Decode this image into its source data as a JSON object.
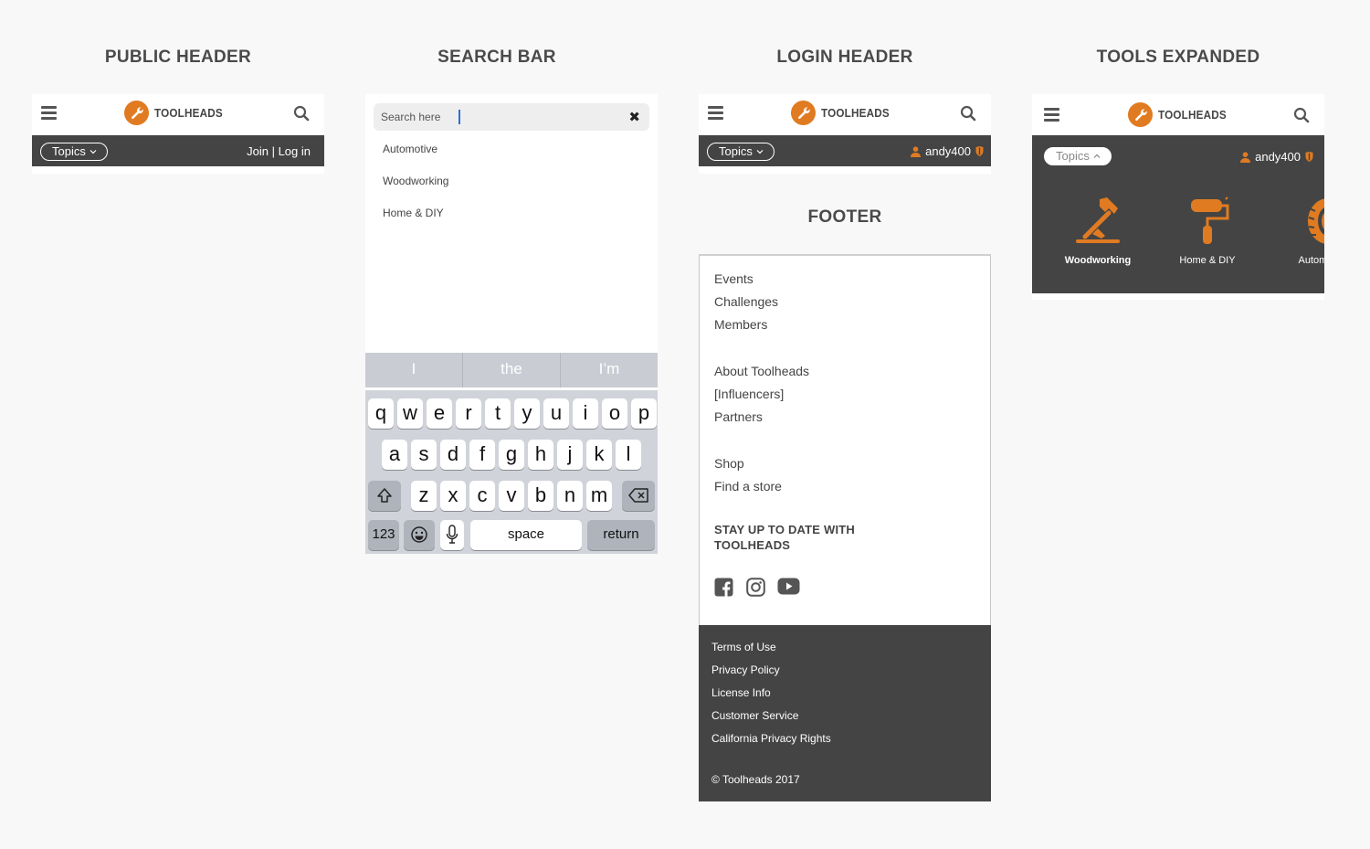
{
  "sections": {
    "public_header": "PUBLIC HEADER",
    "search_bar": "SEARCH BAR",
    "login_header": "LOGIN HEADER",
    "tools_expanded": "TOOLS EXPANDED",
    "footer": "FOOTER"
  },
  "brand": {
    "name": "TOOLHEADS",
    "accent": "#e07b22",
    "dark": "#444444"
  },
  "header": {
    "topics_label": "Topics",
    "auth_label": "Join | Log in",
    "username": "andy400"
  },
  "search": {
    "placeholder": "Search here",
    "suggestions": [
      "Automotive",
      "Woodworking",
      "Home & DIY"
    ]
  },
  "keyboard": {
    "predictions": [
      "I",
      "the",
      "I’m"
    ],
    "row1": [
      "q",
      "w",
      "e",
      "r",
      "t",
      "y",
      "u",
      "i",
      "o",
      "p"
    ],
    "row2": [
      "a",
      "s",
      "d",
      "f",
      "g",
      "h",
      "j",
      "k",
      "l"
    ],
    "row3": [
      "z",
      "x",
      "c",
      "v",
      "b",
      "n",
      "m"
    ],
    "numbers_key": "123",
    "space_key": "space",
    "return_key": "return"
  },
  "footer": {
    "group1": [
      "Events",
      "Challenges",
      "Members"
    ],
    "group2": [
      "About Toolheads",
      "[Influencers]",
      "Partners"
    ],
    "group3": [
      "Shop",
      "Find a store"
    ],
    "newsletter_heading_line1": "STAY UP TO DATE WITH",
    "newsletter_heading_line2": "TOOLHEADS",
    "social_icons": [
      "facebook-icon",
      "instagram-icon",
      "youtube-icon"
    ],
    "legal": [
      "Terms of Use",
      "Privacy Policy",
      "License Info",
      "Customer Service",
      "California Privacy Rights"
    ],
    "copyright": "© Toolheads 2017"
  },
  "tools": [
    {
      "label": "Woodworking",
      "icon": "hammer-icon",
      "active": true
    },
    {
      "label": "Home & DIY",
      "icon": "paint-roller-icon",
      "active": false
    },
    {
      "label": "Automot",
      "icon": "tire-icon",
      "active": false
    }
  ]
}
